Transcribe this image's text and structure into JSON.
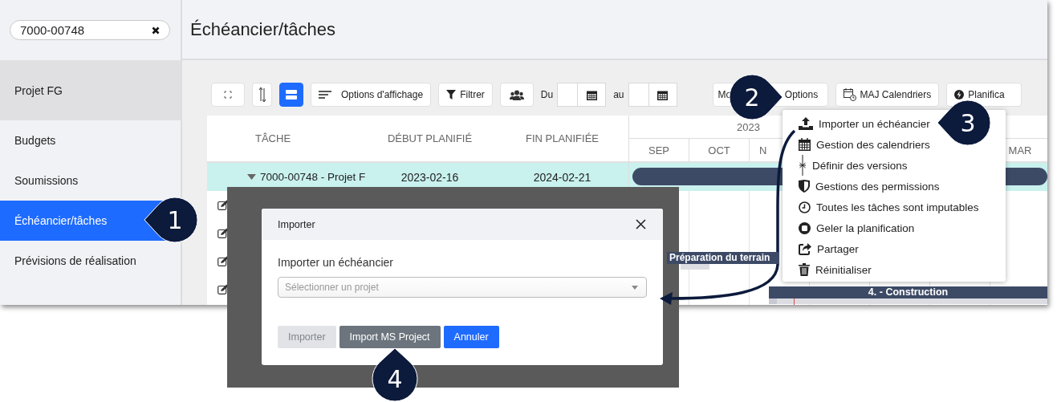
{
  "search": {
    "value": "7000-00748"
  },
  "page_title": "Échéancier/tâches",
  "sidebar": {
    "project": "Projet FG",
    "items": [
      {
        "label": "Budgets",
        "selected": false
      },
      {
        "label": "Soumissions",
        "selected": false
      },
      {
        "label": "Échéancier/tâches",
        "selected": true
      },
      {
        "label": "Prévisions de réalisation",
        "selected": false
      }
    ]
  },
  "toolbar": {
    "view_toggle_on": true,
    "display": "Options d'affichage",
    "filter": "Filtrer",
    "from": "Du",
    "to": "au",
    "mode": "Mo",
    "options": "Options",
    "calendars": "MAJ Calendriers",
    "plan": "Planifica"
  },
  "table": {
    "columns": [
      "TÂCHE",
      "DÉBUT PLANIFIÉ",
      "FIN PLANIFIÉE"
    ],
    "rows": [
      {
        "task": "7000-00748 - Projet F",
        "start": "2023-02-16",
        "end": "2024-02-21",
        "expanded": true,
        "selected": true
      }
    ]
  },
  "gantt": {
    "year": "2023",
    "months": [
      "SEP",
      "OCT",
      "N",
      "MAR"
    ],
    "bars": [
      {
        "label": "Préparation du terrain"
      },
      {
        "label": "4. - Construction"
      }
    ]
  },
  "menu": {
    "items": [
      "Importer un échéancier",
      "Gestion des calendriers",
      "Définir des versions",
      "Gestions des permissions",
      "Toutes les tâches sont imputables",
      "Geler la planification",
      "Partager",
      "Réinitialiser"
    ]
  },
  "dialog": {
    "title": "Importer",
    "field_label": "Importer un échéancier",
    "select_placeholder": "Sélectionner un projet",
    "buttons": [
      {
        "label": "Importer",
        "kind": "primary",
        "disabled": true
      },
      {
        "label": "Import MS Project",
        "kind": "secondary",
        "disabled": false
      },
      {
        "label": "Annuler",
        "kind": "primary",
        "disabled": false
      }
    ]
  },
  "callouts": [
    {
      "number": "1",
      "kind": "left"
    },
    {
      "number": "2",
      "kind": "right"
    },
    {
      "number": "3",
      "kind": "left"
    },
    {
      "number": "4",
      "kind": "up"
    }
  ]
}
